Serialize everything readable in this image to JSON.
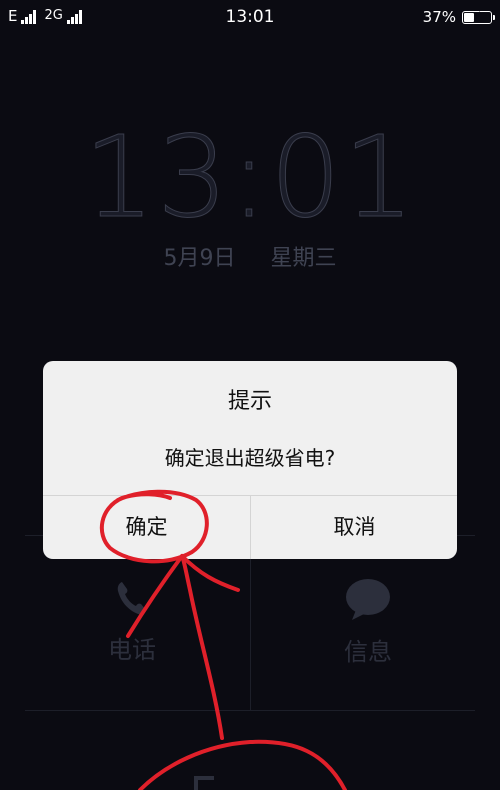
{
  "status_bar": {
    "carrier1": "E",
    "carrier2": "2G",
    "time": "13:01",
    "battery_percent": "37%",
    "battery_level": 0.37
  },
  "lock_screen": {
    "clock": "13:01",
    "date": "5月9日",
    "weekday": "星期三",
    "shortcuts": [
      {
        "label": "电话",
        "icon": "phone-icon"
      },
      {
        "label": "信息",
        "icon": "message-icon"
      }
    ]
  },
  "dialog": {
    "title": "提示",
    "message": "确定退出超级省电?",
    "confirm_label": "确定",
    "cancel_label": "取消"
  },
  "colors": {
    "background": "#0b0b12",
    "dialog_bg": "#f0f0f0",
    "annotation": "#e0202a"
  }
}
